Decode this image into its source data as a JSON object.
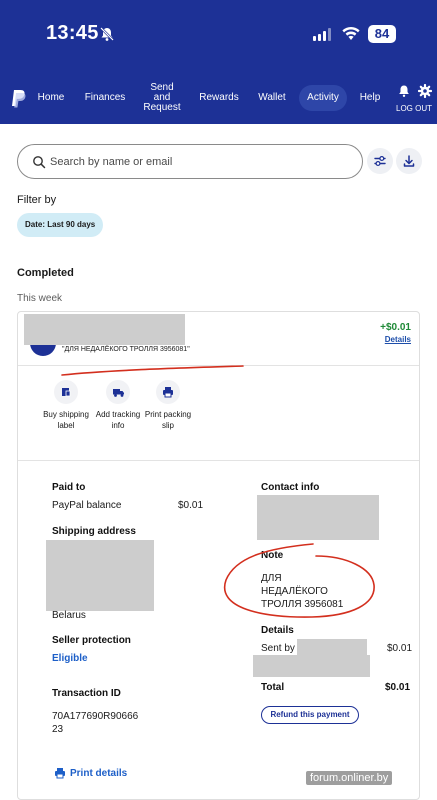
{
  "status_bar": {
    "time": "13:45",
    "battery": "84"
  },
  "nav": {
    "items": [
      "Home",
      "Finances",
      "Send and Request",
      "Rewards",
      "Wallet",
      "Activity",
      "Help"
    ],
    "active": "Activity",
    "logout": "LOG OUT"
  },
  "search": {
    "placeholder": "Search by name or email"
  },
  "filter": {
    "label": "Filter by",
    "chip": "Date: Last 90 days"
  },
  "list": {
    "section": "Completed",
    "period": "This week"
  },
  "transaction": {
    "memo": "\"ДЛЯ НЕДАЛЁКОГО ТРОЛЛЯ 3956081\"",
    "amount": "+$0.01",
    "details_link": "Details",
    "actions": [
      "Buy shipping label",
      "Add tracking info",
      "Print packing slip"
    ],
    "paid_to_label": "Paid to",
    "paid_to_source": "PayPal balance",
    "paid_to_amount": "$0.01",
    "shipping_label": "Shipping address",
    "shipping_country": "Belarus",
    "seller_protection_label": "Seller protection",
    "seller_protection_value": "Eligible",
    "transaction_id_label": "Transaction ID",
    "transaction_id_line1": "70A177690R90666",
    "transaction_id_line2": "23",
    "contact_label": "Contact info",
    "note_label": "Note",
    "note_line1": "ДЛЯ",
    "note_line2": "НЕДАЛЁКОГО",
    "note_line3": "ТРОЛЛЯ 3956081",
    "details_label": "Details",
    "sent_by_label": "Sent by",
    "sent_by_amount": "$0.01",
    "total_label": "Total",
    "total_amount": "$0.01",
    "refund_button": "Refund this payment",
    "print_details": "Print details"
  },
  "watermark": "forum.onliner.by",
  "colors": {
    "brand": "#1d3196",
    "positive": "#1f8a37",
    "link": "#1d5fc8",
    "chip": "#d1ecf6",
    "annotation": "#d32f1e"
  }
}
